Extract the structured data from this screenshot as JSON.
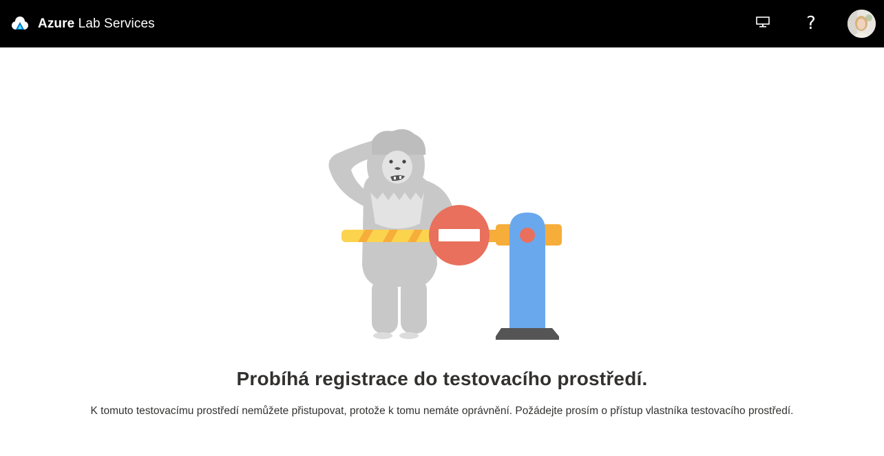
{
  "header": {
    "brand_bold": "Azure",
    "brand_rest": " Lab Services",
    "logo_icon": "azure-lab-services-cloud-icon",
    "vm_icon": "monitor-icon",
    "help_label": "?",
    "avatar_icon": "user-avatar"
  },
  "main": {
    "illustration": "yeti-blocked-by-barrier",
    "title": "Probíhá registrace do testovacího prostředí.",
    "message": "K tomuto testovacímu prostředí nemůžete přistupovat, protože k tomu nemáte oprávnění. Požádejte prosím o přístup vlastníka testovacího prostředí."
  },
  "colors": {
    "topbar_bg": "#000000",
    "barrier_yellow": "#FCD34D",
    "barrier_orange": "#F6AD3A",
    "stop_sign_red": "#E8705D",
    "post_blue": "#6AA8EE",
    "base_gray": "#555555",
    "yeti_gray": "#C8C8C8"
  }
}
